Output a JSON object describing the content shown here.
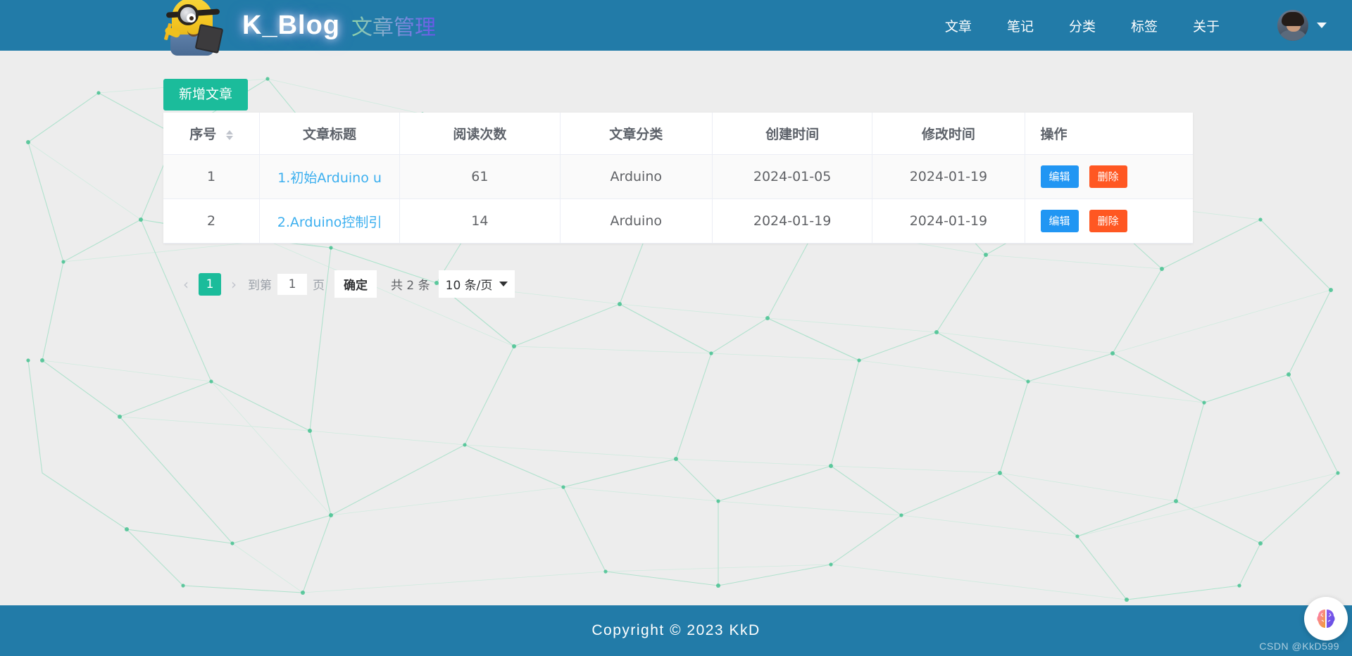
{
  "header": {
    "logo_icon": "minion-logo",
    "brand": "K_Blog",
    "subtitle": "文章管理",
    "nav": [
      {
        "label": "文章"
      },
      {
        "label": "笔记"
      },
      {
        "label": "分类"
      },
      {
        "label": "标签"
      },
      {
        "label": "关于"
      }
    ],
    "avatar_icon": "user-avatar",
    "dropdown_icon": "chevron-down-icon",
    "bg_color": "#227BA8"
  },
  "toolbar": {
    "add_label": "新增文章",
    "add_color": "#1BBC9B"
  },
  "table": {
    "columns": [
      {
        "label": "序号",
        "sortable": true
      },
      {
        "label": "文章标题",
        "sortable": false
      },
      {
        "label": "阅读次数",
        "sortable": false
      },
      {
        "label": "文章分类",
        "sortable": false
      },
      {
        "label": "创建时间",
        "sortable": false
      },
      {
        "label": "修改时间",
        "sortable": false
      },
      {
        "label": "操作",
        "sortable": false
      }
    ],
    "rows": [
      {
        "index": "1",
        "title": "1.初始Arduino u",
        "reads": "61",
        "category": "Arduino",
        "created": "2024-01-05",
        "modified": "2024-01-19",
        "edit_label": "编辑",
        "delete_label": "删除"
      },
      {
        "index": "2",
        "title": "2.Arduino控制引",
        "reads": "14",
        "category": "Arduino",
        "created": "2024-01-19",
        "modified": "2024-01-19",
        "edit_label": "编辑",
        "delete_label": "删除"
      }
    ],
    "link_color": "#3BAFEF",
    "edit_color": "#2196F3",
    "delete_color": "#FF5722"
  },
  "pagination": {
    "prev_icon": "chevron-left-icon",
    "next_icon": "chevron-right-icon",
    "current_page": "1",
    "goto_prefix": "到第",
    "goto_value": "1",
    "goto_suffix": "页",
    "confirm_label": "确定",
    "total_label": "共 2 条",
    "page_size_label": "10 条/页",
    "page_size_icon": "chevron-down-icon",
    "active_color": "#1BBC9B"
  },
  "footer": {
    "text": "Copyright © 2023 KkD",
    "bg_color": "#227BA8"
  },
  "watermark": {
    "text": "CSDN @KkD599"
  },
  "fab": {
    "icon": "brain-icon"
  },
  "background": {
    "color": "#ededed",
    "mesh_color": "#8fe0bd"
  }
}
